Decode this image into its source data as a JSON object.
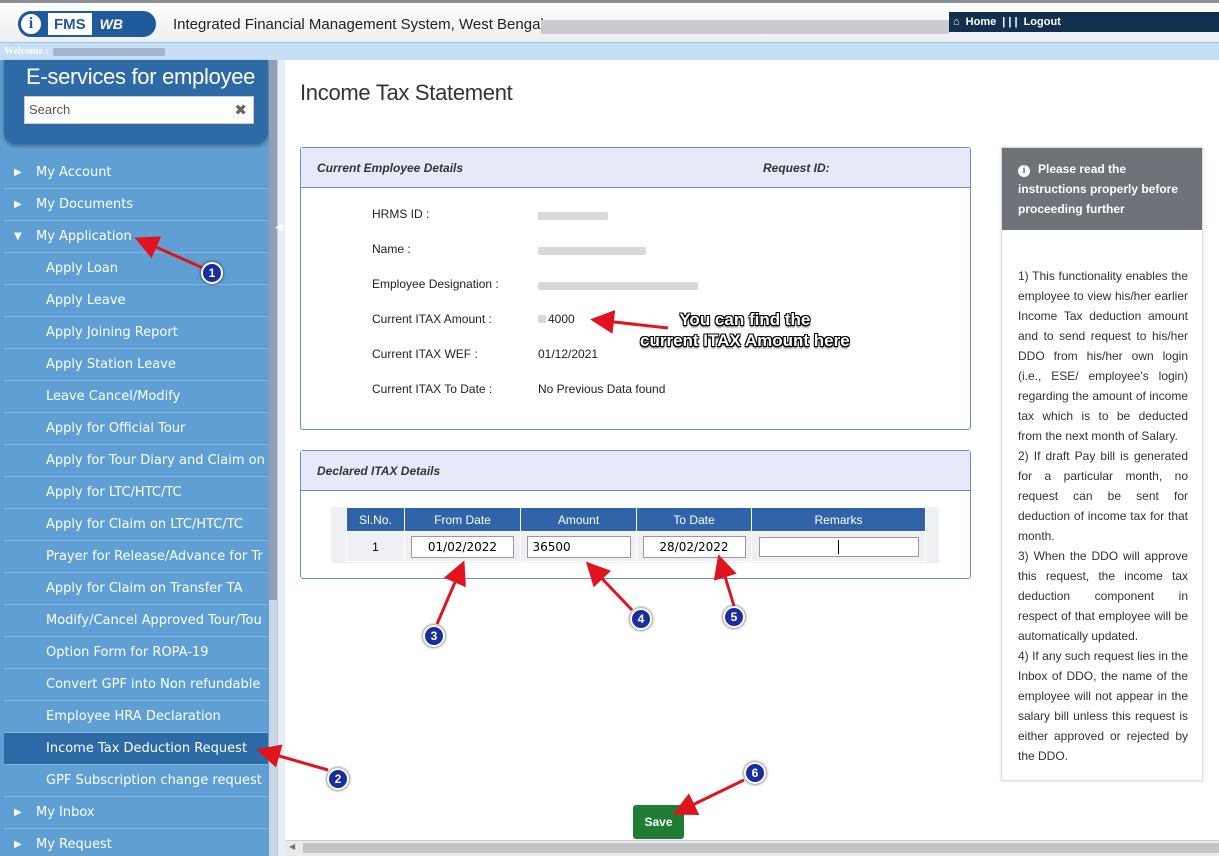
{
  "header": {
    "logo_i": "i",
    "logo_fms": "FMS",
    "logo_wb": "WB",
    "title": "Integrated Financial Management System, West Bengal",
    "nav_home": "Home",
    "nav_sep": "| | |",
    "nav_logout": "Logout",
    "welcome": "Welcome :"
  },
  "sidebar": {
    "title": "E-services for employee",
    "search_placeholder": "Search",
    "clear_glyph": "✖",
    "items": [
      {
        "label": "My Account",
        "level": "top",
        "glyph": "▶"
      },
      {
        "label": "My Documents",
        "level": "top",
        "glyph": "▶"
      },
      {
        "label": "My Application",
        "level": "top",
        "glyph": "▼"
      },
      {
        "label": "Apply Loan",
        "level": "sub"
      },
      {
        "label": "Apply Leave",
        "level": "sub"
      },
      {
        "label": "Apply Joining Report",
        "level": "sub"
      },
      {
        "label": "Apply Station Leave",
        "level": "sub"
      },
      {
        "label": "Leave Cancel/Modify",
        "level": "sub"
      },
      {
        "label": "Apply for Official Tour",
        "level": "sub"
      },
      {
        "label": "Apply for Tour Diary and Claim on",
        "level": "sub"
      },
      {
        "label": "Apply for LTC/HTC/TC",
        "level": "sub"
      },
      {
        "label": "Apply for Claim on LTC/HTC/TC",
        "level": "sub"
      },
      {
        "label": "Prayer for Release/Advance for Tr",
        "level": "sub"
      },
      {
        "label": "Apply for Claim on Transfer TA",
        "level": "sub"
      },
      {
        "label": "Modify/Cancel Approved Tour/Tou",
        "level": "sub"
      },
      {
        "label": "Option Form for ROPA-19",
        "level": "sub"
      },
      {
        "label": "Convert GPF into Non refundable",
        "level": "sub"
      },
      {
        "label": "Employee HRA Declaration",
        "level": "sub"
      },
      {
        "label": "Income Tax Deduction Request",
        "level": "sub",
        "active": true
      },
      {
        "label": "GPF Subscription change request",
        "level": "sub"
      },
      {
        "label": "My Inbox",
        "level": "top",
        "glyph": "▶"
      },
      {
        "label": "My Request",
        "level": "top",
        "glyph": "▶"
      }
    ]
  },
  "main": {
    "page_title": "Income Tax Statement",
    "emp_panel": {
      "title": "Current Employee Details",
      "request_label": "Request ID:",
      "fields": [
        {
          "label": "HRMS ID :",
          "value": ""
        },
        {
          "label": "Name :",
          "value": ""
        },
        {
          "label": "Employee Designation :",
          "value": ""
        },
        {
          "label": "Current ITAX Amount :",
          "value": "4000"
        },
        {
          "label": "Current ITAX WEF :",
          "value": "01/12/2021"
        },
        {
          "label": "Current ITAX To Date :",
          "value": "No Previous Data found"
        }
      ]
    },
    "declared_panel": {
      "title": "Declared ITAX Details",
      "columns": [
        "Sl.No.",
        "From Date",
        "Amount",
        "To Date",
        "Remarks"
      ],
      "row": {
        "slno": "1",
        "from_date": "01/02/2022",
        "amount": "36500",
        "to_date": "28/02/2022",
        "remarks": ""
      }
    },
    "save_label": "Save"
  },
  "instructions": {
    "header": "Please read the instructions properly before proceeding further",
    "info_glyph": "i",
    "items": [
      "1) This functionality enables the employee to view his/her earlier Income Tax deduction amount and to send request to his/her DDO from his/her own login (i.e., ESE/ employee's login) regarding the amount of income tax which is to be deducted from the next month of Salary.",
      "2) If draft Pay bill is generated for a particular month, no request can be sent for deduction of income tax for that month.",
      "3) When the DDO will approve this request, the income tax deduction component in respect of that employee will be automatically updated.",
      "4) If any such request lies in the Inbox of DDO, the name of the employee will not appear in the salary bill unless this request is either approved or rejected by the DDO."
    ]
  },
  "annotations": {
    "callout": [
      "You can find the",
      "current ITAX Amount here"
    ],
    "badges": [
      "1",
      "2",
      "3",
      "4",
      "5",
      "6"
    ]
  },
  "colors": {
    "sidebar_bg": "#5f9fd4",
    "sidebar_active": "#2d6aa6",
    "table_header": "#2f64a8",
    "save_button": "#1e7d33",
    "badge": "#1a2d9e",
    "arrow": "#e0141e"
  }
}
